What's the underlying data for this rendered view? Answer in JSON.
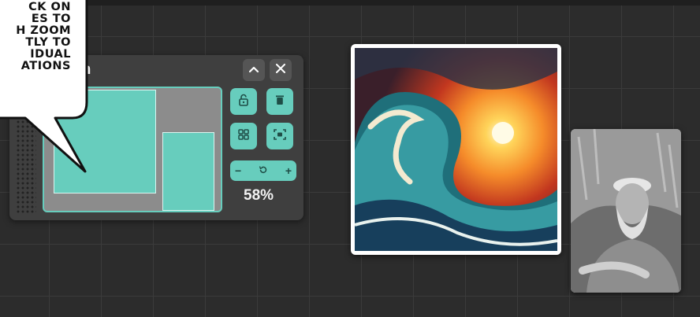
{
  "callout": {
    "lines": [
      "CK ON",
      "ES TO",
      "H ZOOM",
      "TLY TO",
      "IDUAL",
      "ATIONS"
    ]
  },
  "navigation_panel": {
    "title": "ation",
    "collapse_icon": "chevron-up-icon",
    "close_icon": "close-icon",
    "tools": {
      "lock_icon": "unlock-icon",
      "delete_icon": "trash-icon",
      "grid_icon": "grid-icon",
      "fit_icon": "fit-to-screen-icon"
    },
    "zoom": {
      "minus": "−",
      "reset_icon": "reset-zoom-icon",
      "plus": "+",
      "percent": "58%"
    }
  },
  "canvas_items": {
    "artwork": "wave-artwork",
    "photo": "portrait-photo"
  },
  "colors": {
    "accent": "#67cdbd",
    "panel": "#3f3f3f",
    "canvas": "#2c2c2c"
  }
}
